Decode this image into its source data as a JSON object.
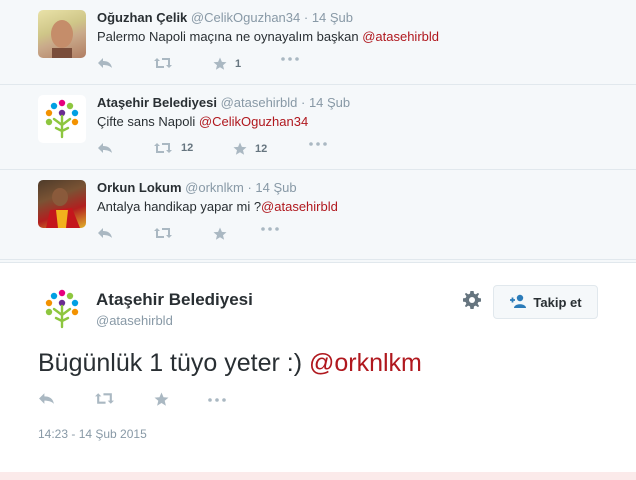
{
  "colors": {
    "mention": "#b0181e",
    "muted": "#8899a6",
    "icon": "#aab8c2"
  },
  "replies": [
    {
      "name": "Oğuzhan Çelik",
      "handle": "@CelikOguzhan34",
      "time": "· 14 Şub",
      "text": "Palermo Napoli maçına ne oynayalım başkan ",
      "mention": "@atasehirbld",
      "retweets": "",
      "favorites": "1"
    },
    {
      "name": "Ataşehir Belediyesi",
      "handle": "@atasehirbld",
      "time": "· 14 Şub",
      "text": "Çifte sans Napoli ",
      "mention": "@CelikOguzhan34",
      "retweets": "12",
      "favorites": "12"
    },
    {
      "name": "Orkun Lokum",
      "handle": "@orknlkm",
      "time": "· 14 Şub",
      "text": "Antalya handikap yapar mi ?",
      "mention": "@atasehirbld",
      "retweets": "",
      "favorites": ""
    }
  ],
  "main": {
    "name": "Ataşehir Belediyesi",
    "handle": "@atasehirbld",
    "follow_label": "Takip et",
    "text": "Bügünlük 1 tüyo yeter :) ",
    "mention": "@orknlkm",
    "timestamp": "14:23 - 14 Şub 2015"
  },
  "icons": {
    "reply": "reply-icon",
    "retweet": "retweet-icon",
    "favorite": "star-icon",
    "more": "more-icon",
    "gear": "gear-icon",
    "follow": "add-user-icon"
  }
}
